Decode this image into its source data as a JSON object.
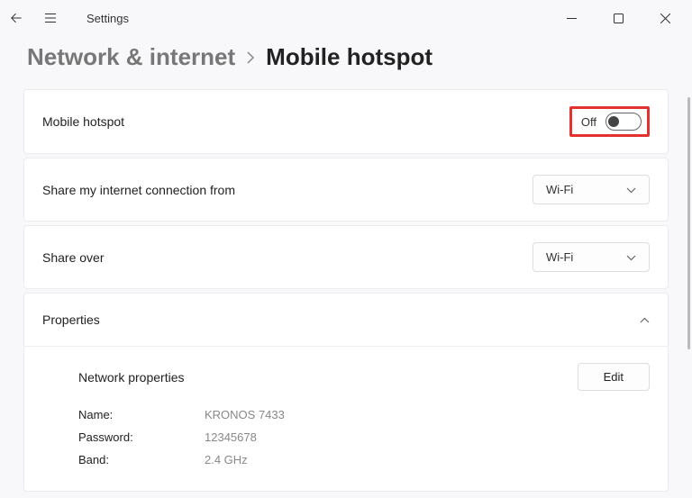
{
  "app": {
    "title": "Settings"
  },
  "breadcrumb": {
    "parent": "Network & internet",
    "current": "Mobile hotspot"
  },
  "hotspot": {
    "label": "Mobile hotspot",
    "toggleState": "Off"
  },
  "shareFrom": {
    "label": "Share my internet connection from",
    "selected": "Wi-Fi"
  },
  "shareOver": {
    "label": "Share over",
    "selected": "Wi-Fi"
  },
  "properties": {
    "heading": "Properties",
    "subtitle": "Network properties",
    "editLabel": "Edit",
    "rows": [
      {
        "key": "Name:",
        "value": "KRONOS 7433"
      },
      {
        "key": "Password:",
        "value": "12345678"
      },
      {
        "key": "Band:",
        "value": "2.4 GHz"
      }
    ]
  }
}
